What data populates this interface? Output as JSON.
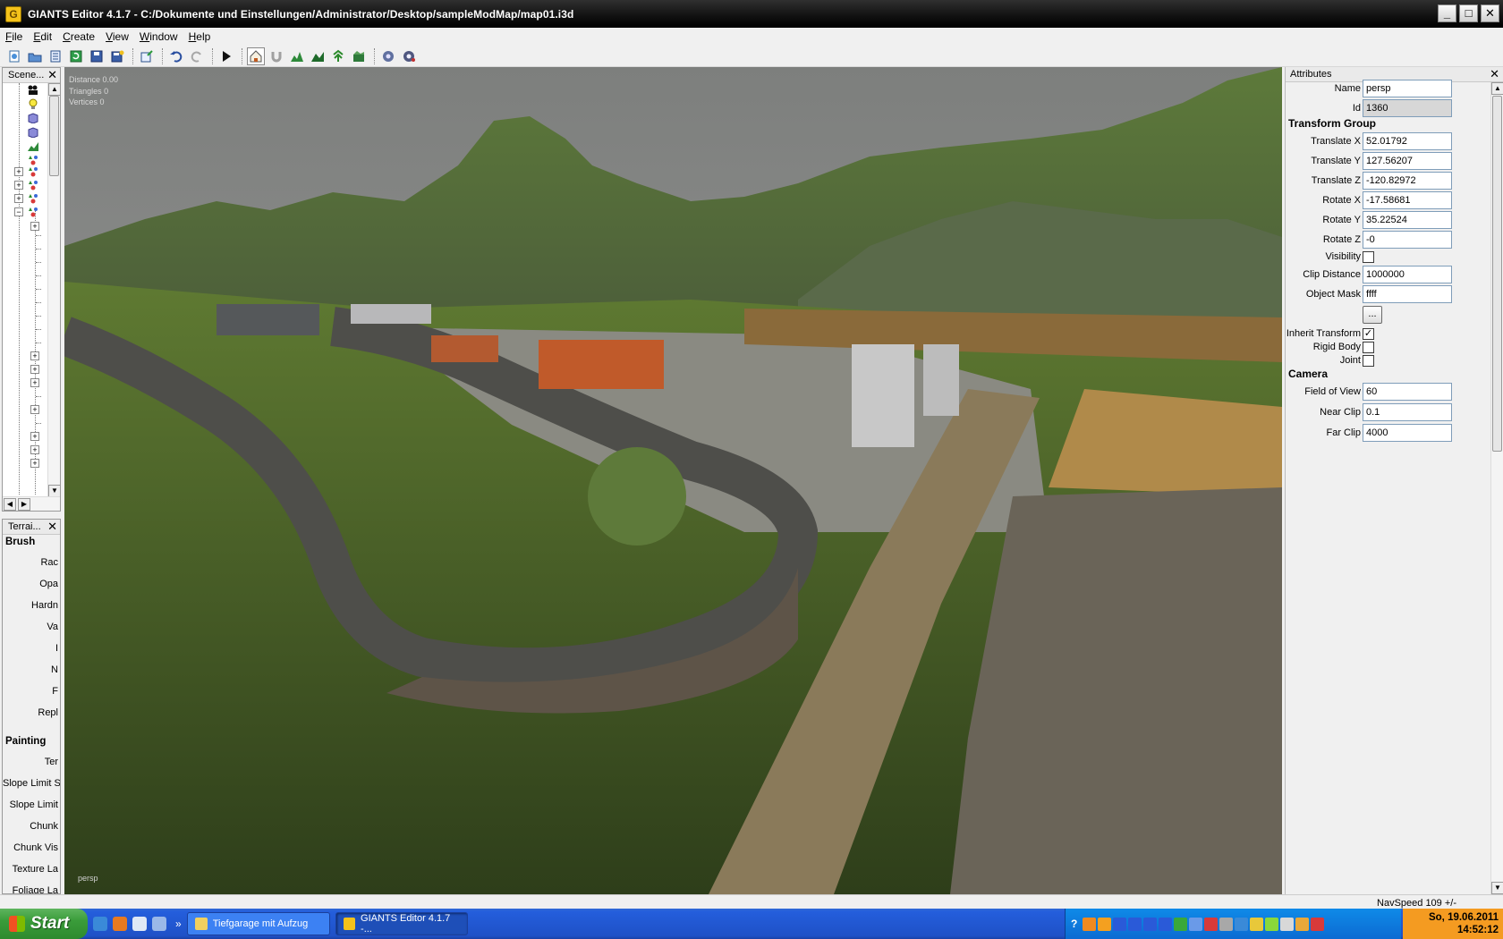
{
  "window": {
    "title": "GIANTS Editor 4.1.7 - C:/Dokumente und Einstellungen/Administrator/Desktop/sampleModMap/map01.i3d",
    "app_icon_letter": "G",
    "controls": {
      "minimize": "_",
      "maximize": "□",
      "close": "✕"
    }
  },
  "menu": {
    "items": [
      "File",
      "Edit",
      "Create",
      "View",
      "Window",
      "Help"
    ]
  },
  "toolbar": {
    "icons": [
      "new-icon",
      "open-icon",
      "list-icon",
      "refresh-icon",
      "save-icon",
      "save-all-icon",
      "import-icon",
      "undo-icon",
      "redo-icon",
      "play-icon",
      "select-icon",
      "magnet-icon",
      "terrain-raise-icon",
      "terrain-paint-icon",
      "foliage-icon",
      "terrain-detail-icon",
      "settings-a-icon",
      "settings-b-icon"
    ]
  },
  "scenegraph": {
    "title": "Scene...",
    "close": "✕"
  },
  "terrain": {
    "title": "Terrai...",
    "close": "✕",
    "brush_header": "Brush",
    "brush_labels": [
      "Rac",
      "Opa",
      "Hardn",
      "Va",
      "I",
      "N",
      "F",
      "Repl"
    ],
    "painting_header": "Painting",
    "painting_labels": [
      "Ter",
      "Slope Limit S",
      "Slope Limit",
      "Chunk",
      "Chunk Vis",
      "Texture La",
      "Foliage La"
    ]
  },
  "viewport": {
    "stats": [
      "Distance 0.00",
      "Triangles 0",
      "Vertices 0"
    ],
    "camera_name": "persp"
  },
  "attributes": {
    "title": "Attributes",
    "close": "✕",
    "name_label": "Name",
    "name_value": "persp",
    "id_label": "Id",
    "id_value": "1360",
    "transform_group_header": "Transform Group",
    "translate_x_label": "Translate X",
    "translate_x": "52.01792",
    "translate_y_label": "Translate Y",
    "translate_y": "127.56207",
    "translate_z_label": "Translate Z",
    "translate_z": "-120.82972",
    "rotate_x_label": "Rotate X",
    "rotate_x": "-17.58681",
    "rotate_y_label": "Rotate Y",
    "rotate_y": "35.22524",
    "rotate_z_label": "Rotate Z",
    "rotate_z": "-0",
    "visibility_label": "Visibility",
    "visibility_checked": false,
    "clip_distance_label": "Clip Distance",
    "clip_distance": "1000000",
    "object_mask_label": "Object Mask",
    "object_mask": "ffff",
    "more_button": "...",
    "inherit_transform_label": "Inherit Transform",
    "inherit_transform_checked": "✓",
    "rigid_body_label": "Rigid Body",
    "joint_label": "Joint",
    "camera_header": "Camera",
    "fov_label": "Field of View",
    "fov": "60",
    "near_clip_label": "Near Clip",
    "near_clip": "0.1",
    "far_clip_label": "Far Clip",
    "far_clip": "4000"
  },
  "status": {
    "navspeed": "NavSpeed 109 +/-"
  },
  "taskbar": {
    "start_label": "Start",
    "quicklaunch_overflow": "»",
    "tasks": [
      {
        "label": "Tiefgarage mit Aufzug"
      },
      {
        "label": "GIANTS Editor 4.1.7 -..."
      }
    ],
    "tray_help": "?",
    "clock_date": "So, 19.06.2011",
    "clock_time": "14:52:12"
  }
}
